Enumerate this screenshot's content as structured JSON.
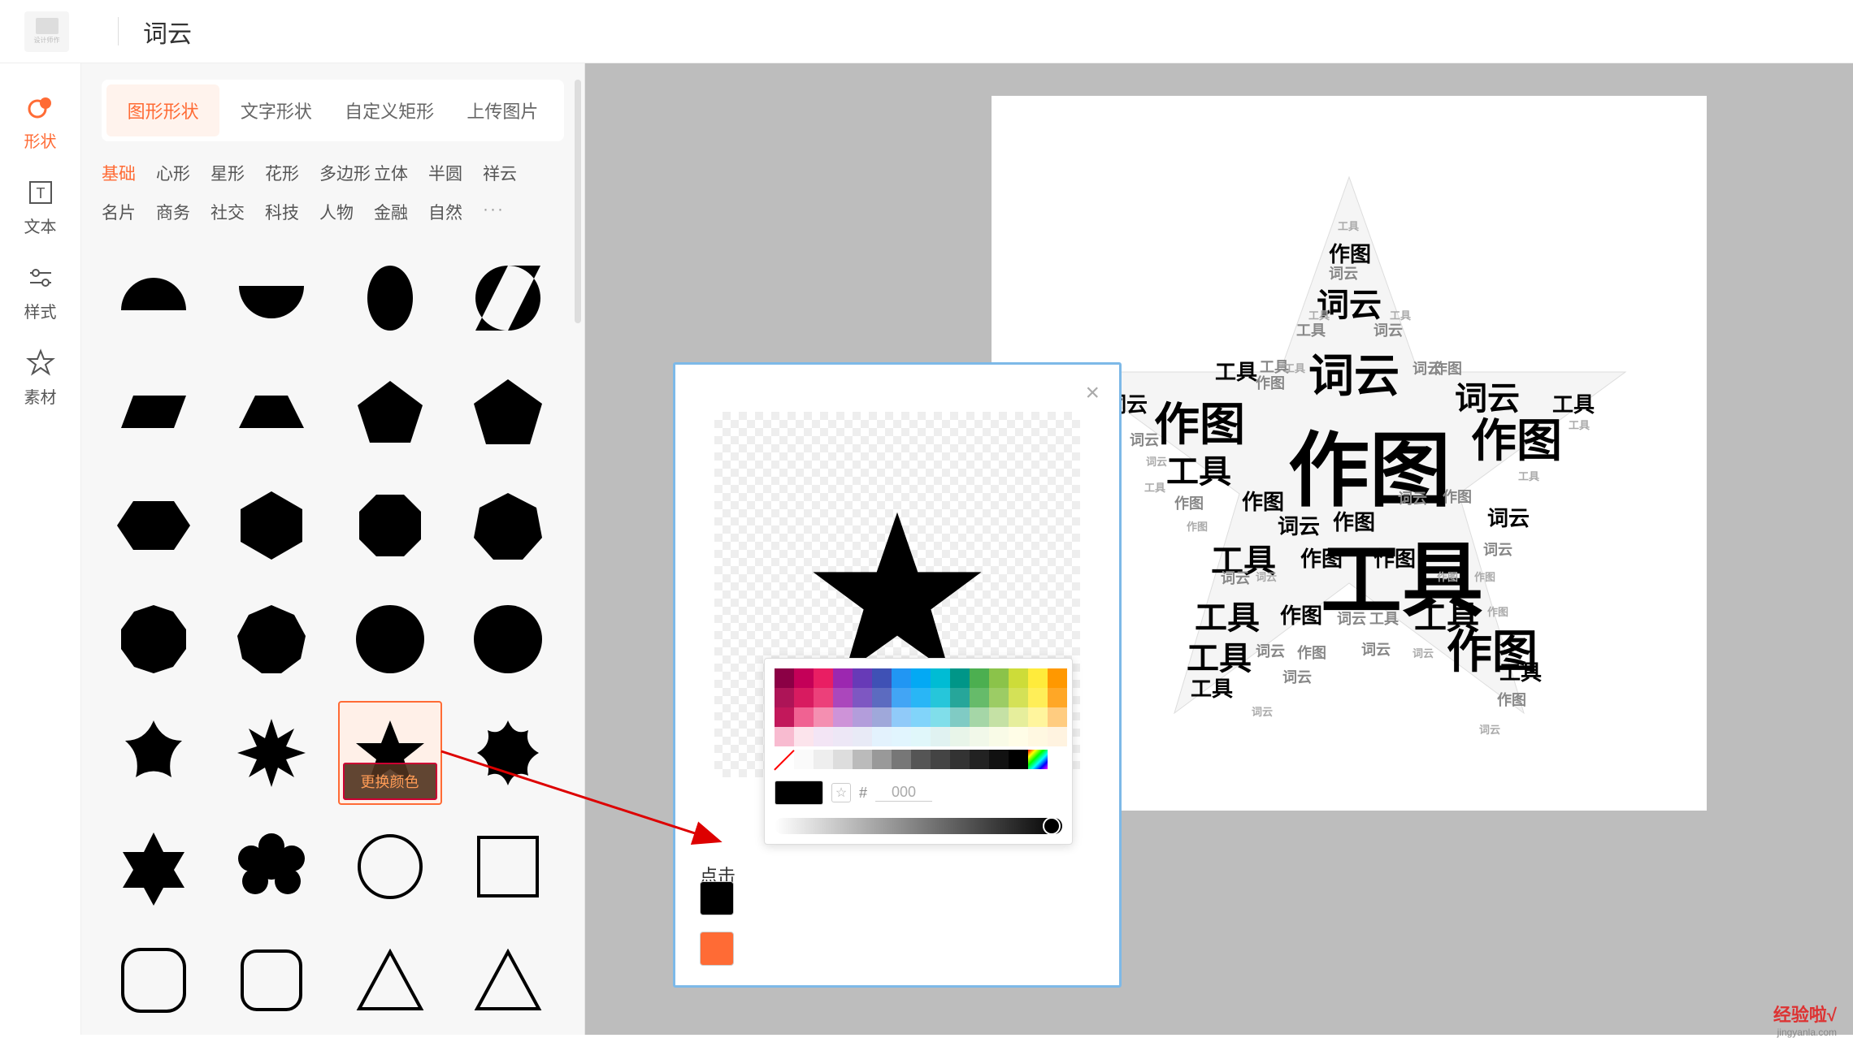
{
  "header": {
    "title": "词云",
    "logo_text": "设计师作"
  },
  "nav": {
    "items": [
      {
        "label": "形状"
      },
      {
        "label": "文本"
      },
      {
        "label": "样式"
      },
      {
        "label": "素材"
      }
    ]
  },
  "tabs": [
    {
      "label": "图形形状",
      "active": true
    },
    {
      "label": "文字形状"
    },
    {
      "label": "自定义矩形"
    },
    {
      "label": "上传图片"
    }
  ],
  "categories_row1": [
    "基础",
    "心形",
    "星形",
    "花形",
    "多边形",
    "立体",
    "半圆",
    "祥云"
  ],
  "categories_row2": [
    "名片",
    "商务",
    "社交",
    "科技",
    "人物",
    "金融",
    "自然",
    "···"
  ],
  "active_category": "基础",
  "change_color_label": "更换颜色",
  "popup": {
    "click_text": "点击"
  },
  "color_picker": {
    "hex_value": "000",
    "hash": "#"
  },
  "word_cloud": {
    "words": [
      "作图",
      "词云",
      "工具"
    ]
  },
  "watermark": {
    "text": "经验啦",
    "check": "√",
    "url": "jingyanla.com"
  }
}
